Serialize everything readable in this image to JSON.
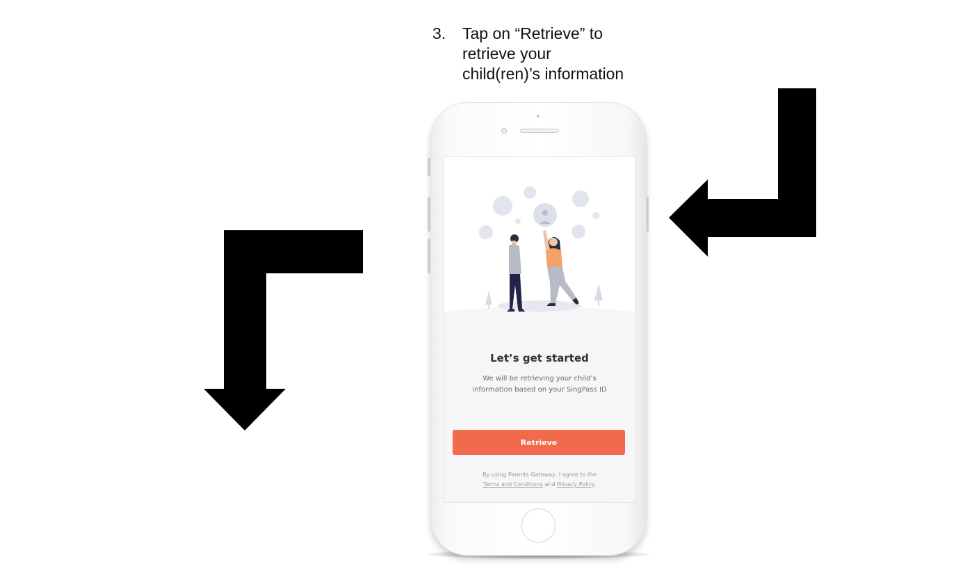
{
  "instruction": {
    "number": "3.",
    "text_line1": "Tap on “Retrieve” to",
    "text_line2": "retrieve your",
    "text_line3": "child(ren)’s information"
  },
  "screen": {
    "headline": "Let’s get started",
    "subtext_line1": "We will be retrieving your child’s",
    "subtext_line2": "information based on your SingPass ID",
    "retrieve_label": "Retrieve",
    "terms_prefix": "By using Parents Gateway, I agree to the",
    "terms_link": "Terms and Conditions",
    "terms_and": "and",
    "privacy_link": "Privacy Policy",
    "terms_suffix": "."
  },
  "colors": {
    "accent": "#f06a4b",
    "arrow": "#000000",
    "illustration_person_top": "#f4a26b",
    "illustration_bubbles": "#dde0ea"
  },
  "icons": {
    "left_arrow": "down-pointing-bent-arrow",
    "right_arrow": "left-pointing-bent-arrow"
  }
}
